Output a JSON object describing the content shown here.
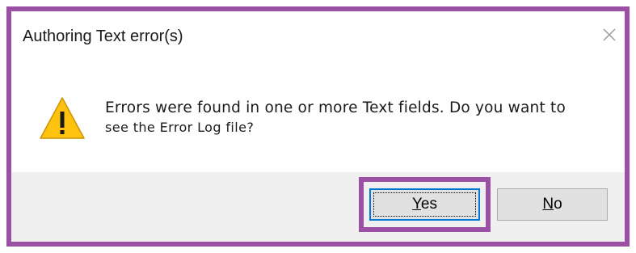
{
  "dialog": {
    "title": "Authoring Text error(s)",
    "close_icon": "close-icon",
    "warning_icon": "warning-icon",
    "message_line1": "Errors were found in one or more Text fields. Do you want to",
    "message_line2": "see the Error Log file?",
    "buttons": {
      "yes": {
        "mnemonic": "Y",
        "rest": "es"
      },
      "no": {
        "mnemonic": "N",
        "rest": "o"
      }
    }
  },
  "colors": {
    "highlight": "#9b4fa5",
    "default_button_border": "#0078d7",
    "warning_fill": "#ffc20e",
    "button_bar": "#f0f0f0"
  }
}
